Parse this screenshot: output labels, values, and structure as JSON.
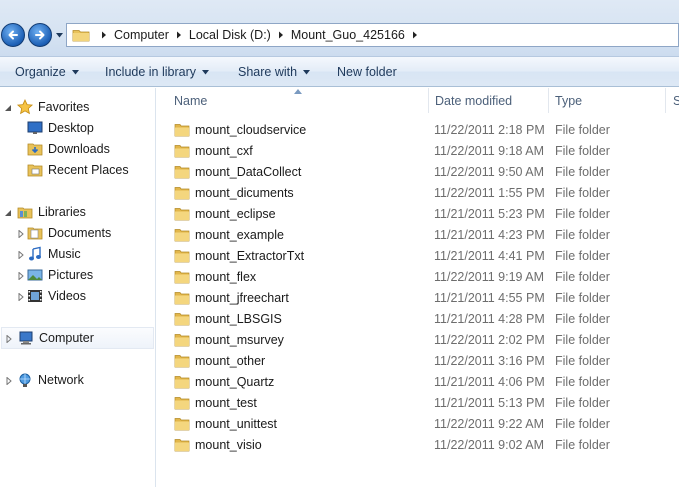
{
  "address_bar": {
    "breadcrumbs": [
      "Computer",
      "Local Disk (D:)",
      "Mount_Guo_425166"
    ]
  },
  "toolbar": {
    "organize": "Organize",
    "include_in_library": "Include in library",
    "share_with": "Share with",
    "new_folder": "New folder"
  },
  "nav": {
    "favorites": "Favorites",
    "desktop": "Desktop",
    "downloads": "Downloads",
    "recent_places": "Recent Places",
    "libraries": "Libraries",
    "documents": "Documents",
    "music": "Music",
    "pictures": "Pictures",
    "videos": "Videos",
    "computer": "Computer",
    "network": "Network"
  },
  "columns": {
    "name": "Name",
    "date_modified": "Date modified",
    "type": "Type",
    "size_partial": "S"
  },
  "files": [
    {
      "name": "mount_cloudservice",
      "date": "11/22/2011 2:18 PM",
      "type": "File folder"
    },
    {
      "name": "mount_cxf",
      "date": "11/22/2011 9:18 AM",
      "type": "File folder"
    },
    {
      "name": "mount_DataCollect",
      "date": "11/22/2011 9:50 AM",
      "type": "File folder"
    },
    {
      "name": "mount_dicuments",
      "date": "11/22/2011 1:55 PM",
      "type": "File folder"
    },
    {
      "name": "mount_eclipse",
      "date": "11/21/2011 5:23 PM",
      "type": "File folder"
    },
    {
      "name": "mount_example",
      "date": "11/21/2011 4:23 PM",
      "type": "File folder"
    },
    {
      "name": "mount_ExtractorTxt",
      "date": "11/21/2011 4:41 PM",
      "type": "File folder"
    },
    {
      "name": "mount_flex",
      "date": "11/22/2011 9:19 AM",
      "type": "File folder"
    },
    {
      "name": "mount_jfreechart",
      "date": "11/21/2011 4:55 PM",
      "type": "File folder"
    },
    {
      "name": "mount_LBSGIS",
      "date": "11/21/2011 4:28 PM",
      "type": "File folder"
    },
    {
      "name": "mount_msurvey",
      "date": "11/22/2011 2:02 PM",
      "type": "File folder"
    },
    {
      "name": "mount_other",
      "date": "11/22/2011 3:16 PM",
      "type": "File folder"
    },
    {
      "name": "mount_Quartz",
      "date": "11/21/2011 4:06 PM",
      "type": "File folder"
    },
    {
      "name": "mount_test",
      "date": "11/21/2011 5:13 PM",
      "type": "File folder"
    },
    {
      "name": "mount_unittest",
      "date": "11/22/2011 9:22 AM",
      "type": "File folder"
    },
    {
      "name": "mount_visio",
      "date": "11/22/2011 9:02 AM",
      "type": "File folder"
    }
  ]
}
